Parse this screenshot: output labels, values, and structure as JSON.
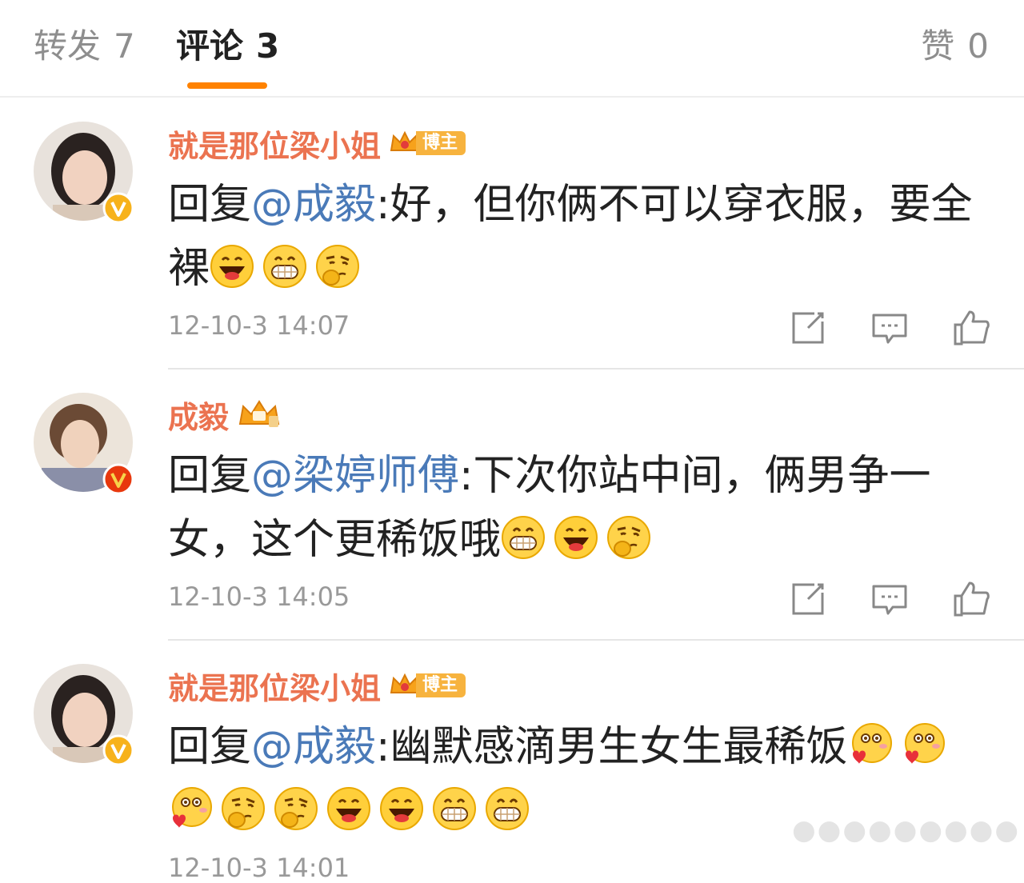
{
  "tabs": {
    "repost": {
      "label": "转发",
      "count": "7"
    },
    "comments": {
      "label": "评论",
      "count": "3"
    },
    "likes": {
      "label": "赞",
      "count": "0"
    }
  },
  "comments": [
    {
      "author": "就是那位梁小姐",
      "badge": "博主",
      "reply_prefix": "回复",
      "mention": "@成毅",
      "text": ":好，但你俩不可以穿衣服，要全裸",
      "emojis": [
        "laughing-emoji",
        "grinning-emoji",
        "thinking-emoji"
      ],
      "timestamp": "12-10-3 14:07"
    },
    {
      "author": "成毅",
      "reply_prefix": "回复",
      "mention": "@梁婷师傅",
      "text": ":下次你站中间，俩男争一女，这个更稀饭哦",
      "emojis": [
        "grinning-emoji",
        "laughing-emoji",
        "thinking-emoji"
      ],
      "timestamp": "12-10-3 14:05"
    },
    {
      "author": "就是那位梁小姐",
      "badge": "博主",
      "reply_prefix": "回复",
      "mention": "@成毅",
      "text": ":幽默感滴男生女生最稀饭",
      "emojis": [
        "love-emoji",
        "love-emoji",
        "love-emoji",
        "thinking-emoji",
        "thinking-emoji",
        "laughing-emoji",
        "laughing-emoji",
        "grinning-emoji",
        "grinning-emoji"
      ],
      "timestamp": "12-10-3 14:01"
    }
  ],
  "colors": {
    "accent": "#ff8200",
    "author": "#eb7350",
    "mention": "#4a7ab8",
    "verified": "#f7b21b"
  }
}
